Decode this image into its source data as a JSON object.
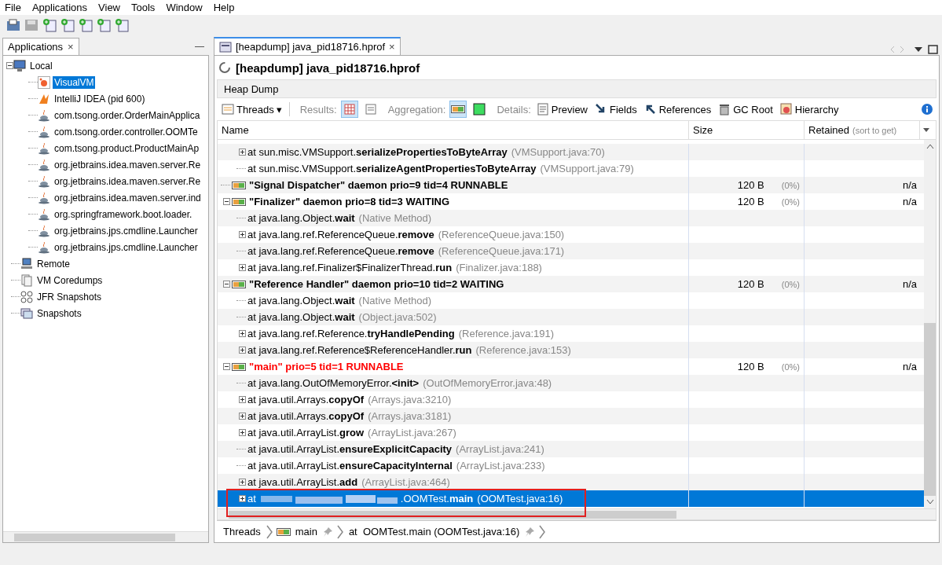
{
  "menu": [
    "File",
    "Applications",
    "View",
    "Tools",
    "Window",
    "Help"
  ],
  "sidebar": {
    "tab": "Applications",
    "tab_close": "×",
    "minimize": "—",
    "tree": [
      {
        "label": "Local",
        "kind": "computer",
        "expanded": true,
        "selected": false,
        "children": [
          {
            "label": "VisualVM",
            "kind": "visualvm",
            "selected": true
          },
          {
            "label": "IntelliJ IDEA (pid 600)",
            "kind": "idea",
            "selected": false
          },
          {
            "label": "com.tsong.order.OrderMainApplica",
            "kind": "java",
            "selected": false
          },
          {
            "label": "com.tsong.order.controller.OOMTe",
            "kind": "java",
            "selected": false
          },
          {
            "label": "com.tsong.product.ProductMainAp",
            "kind": "java",
            "selected": false
          },
          {
            "label": "org.jetbrains.idea.maven.server.Re",
            "kind": "java",
            "selected": false
          },
          {
            "label": "org.jetbrains.idea.maven.server.Re",
            "kind": "java",
            "selected": false
          },
          {
            "label": "org.jetbrains.idea.maven.server.ind",
            "kind": "java",
            "selected": false
          },
          {
            "label": "org.springframework.boot.loader.",
            "kind": "java",
            "selected": false
          },
          {
            "label": "org.jetbrains.jps.cmdline.Launcher",
            "kind": "java",
            "selected": false
          },
          {
            "label": "org.jetbrains.jps.cmdline.Launcher",
            "kind": "java",
            "selected": false
          }
        ]
      },
      {
        "label": "Remote",
        "kind": "remote",
        "selected": false
      },
      {
        "label": "VM Coredumps",
        "kind": "coredump",
        "selected": false
      },
      {
        "label": "JFR Snapshots",
        "kind": "jfr",
        "selected": false
      },
      {
        "label": "Snapshots",
        "kind": "snapshot",
        "selected": false
      }
    ]
  },
  "document": {
    "tab": "[heapdump] java_pid18716.hprof",
    "tab_close": "×",
    "title": "[heapdump] java_pid18716.hprof",
    "section": "Heap Dump",
    "toolbar": {
      "view": "Threads",
      "view_caret": "▾",
      "results_label": "Results:",
      "results": [
        {
          "kind": "table",
          "selected": true
        },
        {
          "kind": "text",
          "selected": false
        }
      ],
      "aggregation_label": "Aggregation:",
      "aggregation": [
        {
          "kind": "thread",
          "selected": true
        },
        {
          "kind": "green",
          "selected": false
        }
      ],
      "details_label": "Details:",
      "details": [
        {
          "label": "Preview",
          "kind": "preview"
        },
        {
          "label": "Fields",
          "kind": "fields"
        },
        {
          "label": "References",
          "kind": "references"
        },
        {
          "label": "GC Root",
          "kind": "trash"
        },
        {
          "label": "Hierarchy",
          "kind": "hierarchy"
        }
      ]
    },
    "table": {
      "columns": [
        {
          "label": "Name"
        },
        {
          "label": "Size"
        },
        {
          "label": "Retained",
          "hint": "(sort to get)"
        }
      ],
      "orphan_frames": [
        {
          "text": "at sun.misc.VMSupport.**serializePropertiesToByteArray**",
          "location": "(VMSupport.java:70)",
          "kind": "node",
          "expanded": false,
          "selected": false
        },
        {
          "text": "at sun.misc.VMSupport.**serializeAgentPropertiesToByteArray**",
          "location": "(VMSupport.java:79)",
          "kind": "leaf",
          "selected": false
        }
      ],
      "threads": [
        {
          "name": "\"Signal Dispatcher\" daemon prio=9 tid=4 RUNNABLE",
          "color": "#000000",
          "kind": "leaf",
          "selected": false,
          "size": "120 B",
          "percent": "(0%)",
          "retained": "n/a"
        },
        {
          "name": "\"Finalizer\" daemon prio=8 tid=3 WAITING",
          "color": "#000000",
          "kind": "node",
          "expanded": true,
          "selected": false,
          "size": "120 B",
          "percent": "(0%)",
          "retained": "n/a",
          "children": [
            {
              "text": "at java.lang.Object.**wait**",
              "location": "(Native Method)",
              "kind": "leaf",
              "selected": false
            },
            {
              "text": "at java.lang.ref.ReferenceQueue.**remove**",
              "location": "(ReferenceQueue.java:150)",
              "kind": "node",
              "expanded": false,
              "selected": false
            },
            {
              "text": "at java.lang.ref.ReferenceQueue.**remove**",
              "location": "(ReferenceQueue.java:171)",
              "kind": "leaf",
              "selected": false
            },
            {
              "text": "at java.lang.ref.Finalizer$FinalizerThread.**run**",
              "location": "(Finalizer.java:188)",
              "kind": "node",
              "expanded": false,
              "selected": false
            }
          ]
        },
        {
          "name": "\"Reference Handler\" daemon prio=10 tid=2 WAITING",
          "color": "#000000",
          "kind": "node",
          "expanded": true,
          "selected": false,
          "size": "120 B",
          "percent": "(0%)",
          "retained": "n/a",
          "children": [
            {
              "text": "at java.lang.Object.**wait**",
              "location": "(Native Method)",
              "kind": "leaf",
              "selected": false
            },
            {
              "text": "at java.lang.Object.**wait**",
              "location": "(Object.java:502)",
              "kind": "leaf",
              "selected": false
            },
            {
              "text": "at java.lang.ref.Reference.**tryHandlePending**",
              "location": "(Reference.java:191)",
              "kind": "node",
              "expanded": false,
              "selected": false
            },
            {
              "text": "at java.lang.ref.Reference$ReferenceHandler.**run**",
              "location": "(Reference.java:153)",
              "kind": "node",
              "expanded": false,
              "selected": false
            }
          ]
        },
        {
          "name": "\"main\" prio=5 tid=1 RUNNABLE",
          "color": "#ff0000",
          "kind": "node",
          "expanded": true,
          "selected": false,
          "size": "120 B",
          "percent": "(0%)",
          "retained": "n/a",
          "children": [
            {
              "text": "at java.lang.OutOfMemoryError.**<init>**",
              "location": "(OutOfMemoryError.java:48)",
              "kind": "leaf",
              "selected": false
            },
            {
              "text": "at java.util.Arrays.**copyOf**",
              "location": "(Arrays.java:3210)",
              "kind": "node",
              "expanded": false,
              "selected": false
            },
            {
              "text": "at java.util.Arrays.**copyOf**",
              "location": "(Arrays.java:3181)",
              "kind": "node",
              "expanded": false,
              "selected": false
            },
            {
              "text": "at java.util.ArrayList.**grow**",
              "location": "(ArrayList.java:267)",
              "kind": "node",
              "expanded": false,
              "selected": false
            },
            {
              "text": "at java.util.ArrayList.**ensureExplicitCapacity**",
              "location": "(ArrayList.java:241)",
              "kind": "leaf",
              "selected": false
            },
            {
              "text": "at java.util.ArrayList.**ensureCapacityInternal**",
              "location": "(ArrayList.java:233)",
              "kind": "leaf",
              "selected": false
            },
            {
              "text": "at java.util.ArrayList.**add**",
              "location": "(ArrayList.java:464)",
              "kind": "node",
              "expanded": false,
              "selected": false
            },
            {
              "text_before": "at",
              "redacted": true,
              "text": ".OOMTest.**main**",
              "location": "(OOMTest.java:16)",
              "kind": "node",
              "expanded": false,
              "selected": true
            }
          ]
        }
      ]
    },
    "breadcrumb": [
      {
        "label": "Threads",
        "kind": "plain",
        "pinned": false
      },
      {
        "label": "main",
        "kind": "thread",
        "pinned": true
      },
      {
        "label": "at  OOMTest.main (OOMTest.java:16)",
        "kind": "plain",
        "pinned": true
      }
    ]
  }
}
